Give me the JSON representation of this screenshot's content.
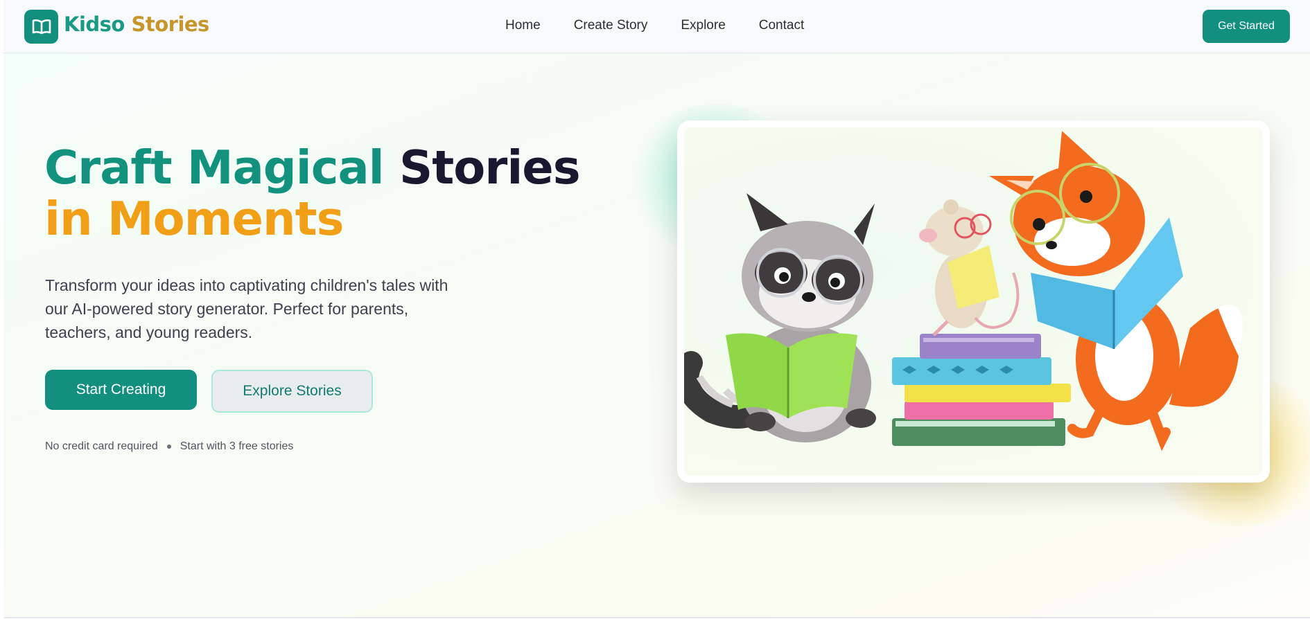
{
  "brand": {
    "name_part1": "Kidso",
    "name_part2": "Stories",
    "logo_icon": "open-book-icon",
    "primary_color": "#138f80",
    "accent_color": "#f29f18"
  },
  "nav": {
    "links": [
      "Home",
      "Create Story",
      "Explore",
      "Contact"
    ],
    "cta_label": "Get Started"
  },
  "hero": {
    "headline_part1": "Craft Magical",
    "headline_part2": "Stories",
    "headline_part3": "in Moments",
    "subtext": "Transform your ideas into captivating children's tales with our AI-powered story generator. Perfect for parents, teachers, and young readers.",
    "primary_button": "Start Creating",
    "secondary_button": "Explore Stories",
    "note_1": "No credit card required",
    "note_2": "Start with 3 free stories"
  },
  "illustration": {
    "subject": "raccoon-mouse-fox-reading-books-illustration"
  }
}
